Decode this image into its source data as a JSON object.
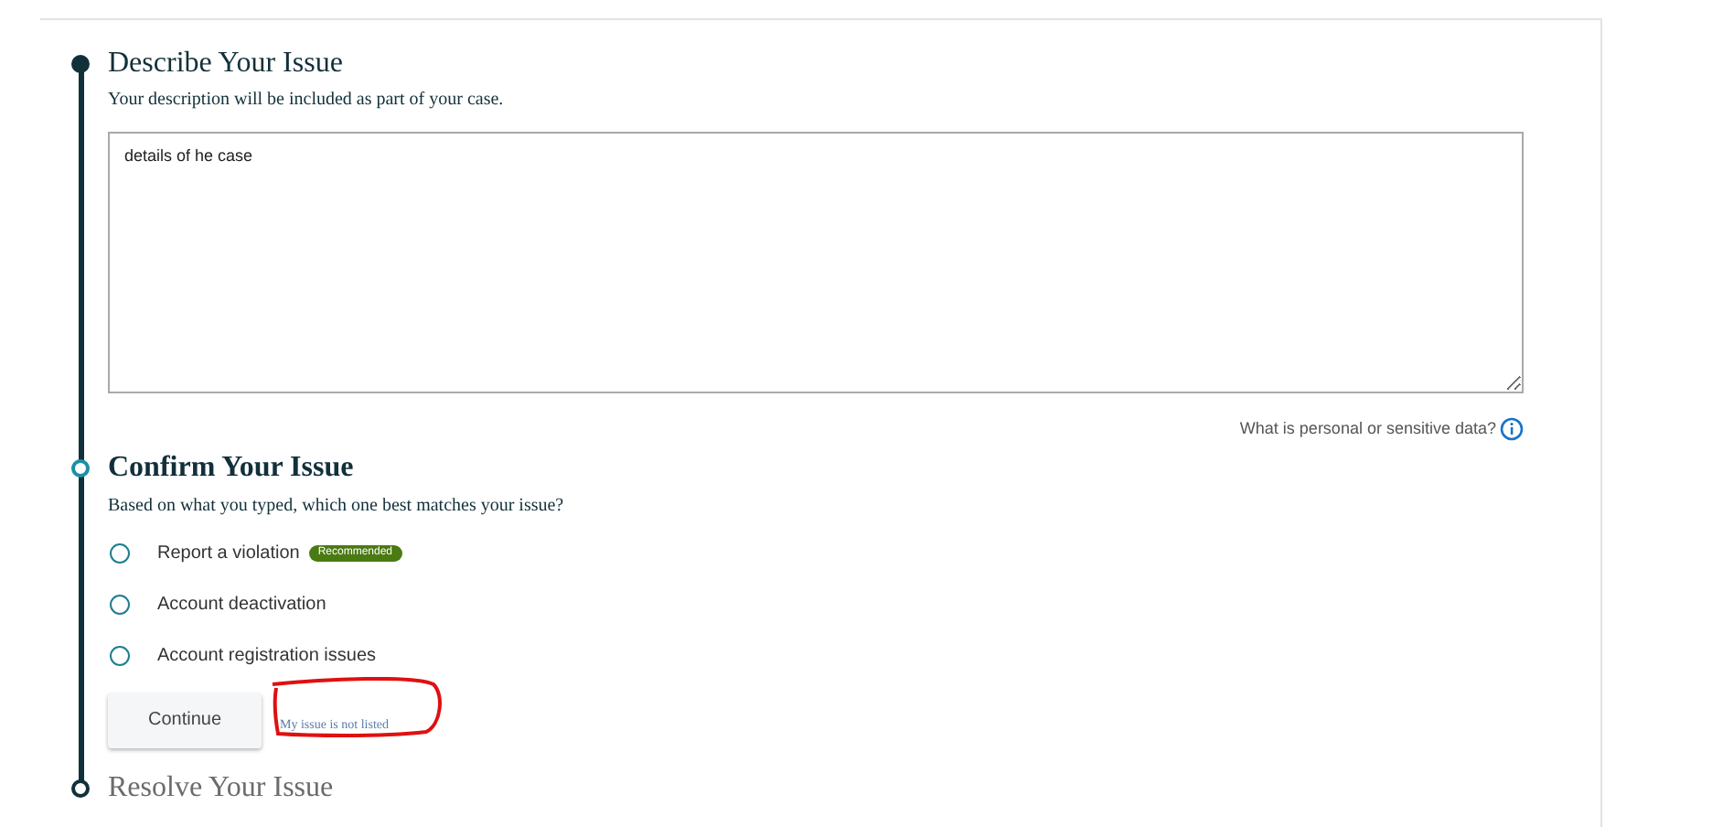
{
  "steps": [
    {
      "title": "Describe Your Issue",
      "kind": "done",
      "subtitle": "Your description will be included as part of your case.",
      "description": {
        "value": "details of he case"
      },
      "help_link": "What is personal or sensitive data?"
    },
    {
      "title": "Confirm Your Issue",
      "kind": "current",
      "subtitle": "Based on what you typed, which one best matches your issue?",
      "options": [
        {
          "label": "Report a violation",
          "badge": "Recommended",
          "selected": false
        },
        {
          "label": "Account deactivation",
          "selected": false
        },
        {
          "label": "Account registration issues",
          "selected": false
        }
      ],
      "continue_button": "Continue",
      "not_listed_link": "My issue is not listed",
      "annotation": true
    },
    {
      "title": "Resolve Your Issue",
      "kind": "upcoming"
    }
  ]
}
